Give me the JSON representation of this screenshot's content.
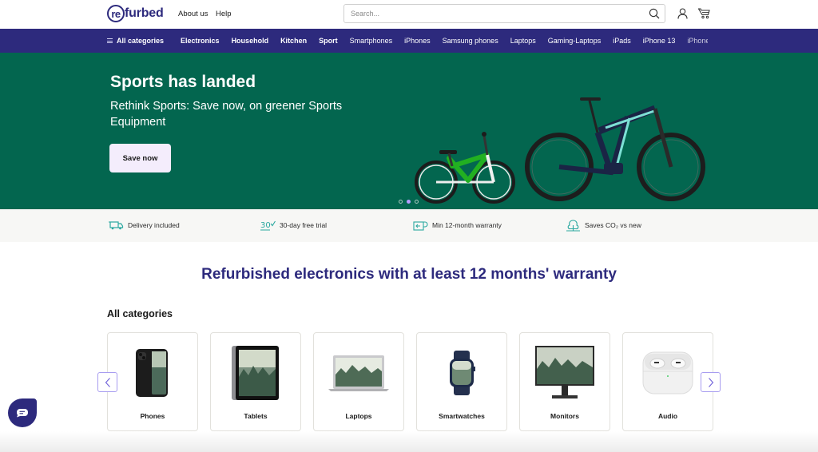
{
  "header": {
    "logo_circle": "re",
    "logo_rest": "furbed",
    "links": [
      "About us",
      "Help"
    ],
    "search_placeholder": "Search...",
    "icons": [
      "search-icon",
      "account-icon",
      "cart-icon"
    ]
  },
  "catnav": {
    "all_label": "All categories",
    "items": [
      "Electronics",
      "Household",
      "Kitchen",
      "Sport",
      "Smartphones",
      "iPhones",
      "Samsung phones",
      "Laptops",
      "Gaming-Laptops",
      "iPads",
      "iPhone 13",
      "iPhone"
    ]
  },
  "hero": {
    "title": "Sports has landed",
    "subtitle": "Rethink Sports: Save now, on greener Sports Equipment",
    "button": "Save now",
    "background": "#03664f",
    "slides_total": 3,
    "active_slide": 2,
    "image": "kids-bike-and-e-mountain-bike"
  },
  "usps": [
    {
      "icon": "delivery-truck-icon",
      "label": "Delivery included"
    },
    {
      "icon": "30-day-check-icon",
      "label": "30-day free trial"
    },
    {
      "icon": "warranty-icon",
      "label": "Min 12-month warranty"
    },
    {
      "icon": "tree-co2-icon",
      "label": "Saves CO₂ vs new"
    }
  ],
  "main": {
    "heading": "Refurbished electronics with at least 12 months' warranty",
    "section_label": "All categories",
    "categories": [
      {
        "label": "Phones",
        "image": "phone"
      },
      {
        "label": "Tablets",
        "image": "tablet"
      },
      {
        "label": "Laptops",
        "image": "laptop"
      },
      {
        "label": "Smartwatches",
        "image": "smartwatch"
      },
      {
        "label": "Monitors",
        "image": "monitor"
      },
      {
        "label": "Audio",
        "image": "earbuds"
      }
    ]
  },
  "colors": {
    "brand": "#2d2a7d",
    "hero_green": "#03664f",
    "accent_teal": "#2ba8a0",
    "button_lilac": "#f4edfc",
    "dot_active": "#b69dff"
  }
}
